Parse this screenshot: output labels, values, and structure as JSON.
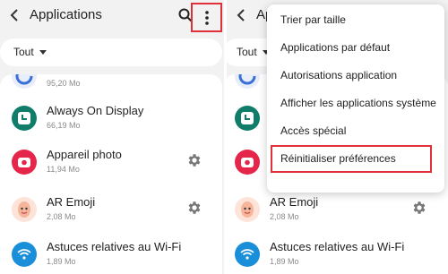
{
  "header": {
    "title": "Applications",
    "title_truncated": "Ap"
  },
  "filter": {
    "label": "Tout"
  },
  "apps": [
    {
      "name": "",
      "size": "95,20 Mo",
      "icon": "partial-app-icon"
    },
    {
      "name": "Always On Display",
      "size": "66,19 Mo",
      "icon": "clock-icon",
      "color": "#0f7d6a"
    },
    {
      "name": "Appareil photo",
      "size": "11,94 Mo",
      "icon": "camera-icon",
      "color": "#e5264a"
    },
    {
      "name": "AR Emoji",
      "size": "2,08 Mo",
      "icon": "emoji-face-icon",
      "color": "#f9c7b5"
    },
    {
      "name": "Astuces relatives au Wi-Fi",
      "size": "1,89 Mo",
      "icon": "wifi-icon",
      "color": "#1a8fd9"
    }
  ],
  "menu": {
    "items": [
      "Trier par taille",
      "Applications par défaut",
      "Autorisations application",
      "Afficher les applications système",
      "Accès spécial",
      "Réinitialiser préférences"
    ],
    "highlighted_index": 5
  },
  "colors": {
    "highlight_border": "#e0303a",
    "background": "#f2f2f2"
  }
}
